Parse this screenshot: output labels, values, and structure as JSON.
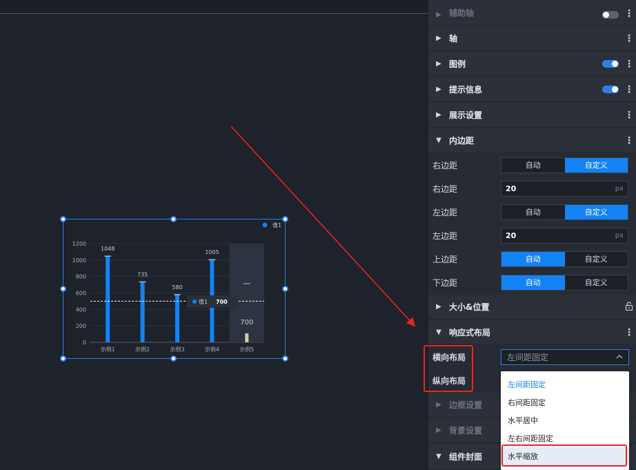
{
  "canvas": {
    "chart_widget": {
      "legend": "值1",
      "tooltip": {
        "series": "值1",
        "value": "700"
      },
      "highlight_label": "一"
    }
  },
  "chart_data": {
    "type": "bar",
    "categories": [
      "示例1",
      "示例2",
      "示例3",
      "示例4",
      "示例5"
    ],
    "series": [
      {
        "name": "值1",
        "values": [
          1048,
          735,
          580,
          1005,
          700
        ]
      }
    ],
    "data_labels": [
      "1048",
      "735",
      "580",
      "1005",
      "700"
    ],
    "ylim": [
      0,
      1200
    ],
    "yticks": [
      "0",
      "200",
      "400",
      "600",
      "800",
      "1000",
      "1200"
    ],
    "reference_line": 500,
    "highlighted_category": "示例5",
    "colors": {
      "bar": "#1283f5",
      "highlight_bar": "#d8c9a8",
      "frame": "#2f7fe8"
    }
  },
  "panel": {
    "sections": {
      "auxiliary_axis": "辅助轴",
      "axis": "轴",
      "legend": "图例",
      "tooltip": "提示信息",
      "display": "展示设置",
      "padding": "内边距",
      "size_position": "大小&位置",
      "responsive": "响应式布局",
      "border": "边框设置",
      "background": "背景设置",
      "cover": "组件封面"
    },
    "padding_rows": [
      {
        "label": "右边距",
        "opt_a": "自动",
        "opt_b": "自定义"
      },
      {
        "label": "右边距",
        "value": "20",
        "unit": "px"
      },
      {
        "label": "左边距",
        "opt_a": "自动",
        "opt_b": "自定义"
      },
      {
        "label": "左边距",
        "value": "20",
        "unit": "px"
      },
      {
        "label": "上边距",
        "opt_a": "自动",
        "opt_b": "自定义"
      },
      {
        "label": "下边距",
        "opt_a": "自动",
        "opt_b": "自定义"
      }
    ],
    "responsive": {
      "horizontal_label": "横向布局",
      "vertical_label": "纵向布局",
      "selected": "左间距固定",
      "options": [
        "左间距固定",
        "右间距固定",
        "水平居中",
        "左右间距固定",
        "水平缩放"
      ]
    }
  }
}
